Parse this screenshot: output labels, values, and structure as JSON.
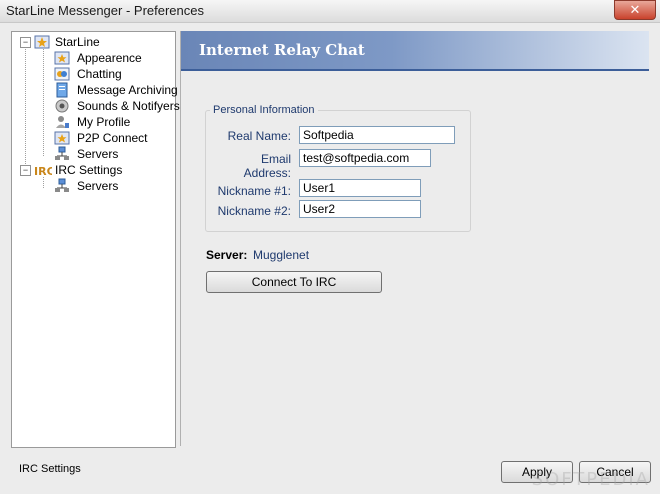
{
  "window": {
    "title": "StarLine Messenger - Preferences",
    "close_label": "✕"
  },
  "tree": {
    "starline": {
      "label": "StarLine",
      "items": [
        {
          "label": "Appearence"
        },
        {
          "label": "Chatting"
        },
        {
          "label": "Message Archiving"
        },
        {
          "label": "Sounds & Notifyers"
        },
        {
          "label": "My Profile"
        },
        {
          "label": "P2P Connect"
        },
        {
          "label": "Servers"
        }
      ]
    },
    "irc": {
      "label": "IRC Settings",
      "items": [
        {
          "label": "Servers"
        }
      ]
    }
  },
  "panel": {
    "title": "Internet Relay Chat",
    "group_label": "Personal Information",
    "fields": {
      "real_name": {
        "label": "Real Name:",
        "value": "Softpedia"
      },
      "email": {
        "label": "Email Address:",
        "value": "test@softpedia.com"
      },
      "nick1": {
        "label": "Nickname #1:",
        "value": "User1"
      },
      "nick2": {
        "label": "Nickname #2:",
        "value": "User2"
      }
    },
    "server_label": "Server:",
    "server_value": "Mugglenet",
    "connect_button": "Connect To IRC"
  },
  "footer": {
    "status": "IRC Settings",
    "apply": "Apply",
    "cancel": "Cancel"
  },
  "watermark": "SOFTPEDIA"
}
